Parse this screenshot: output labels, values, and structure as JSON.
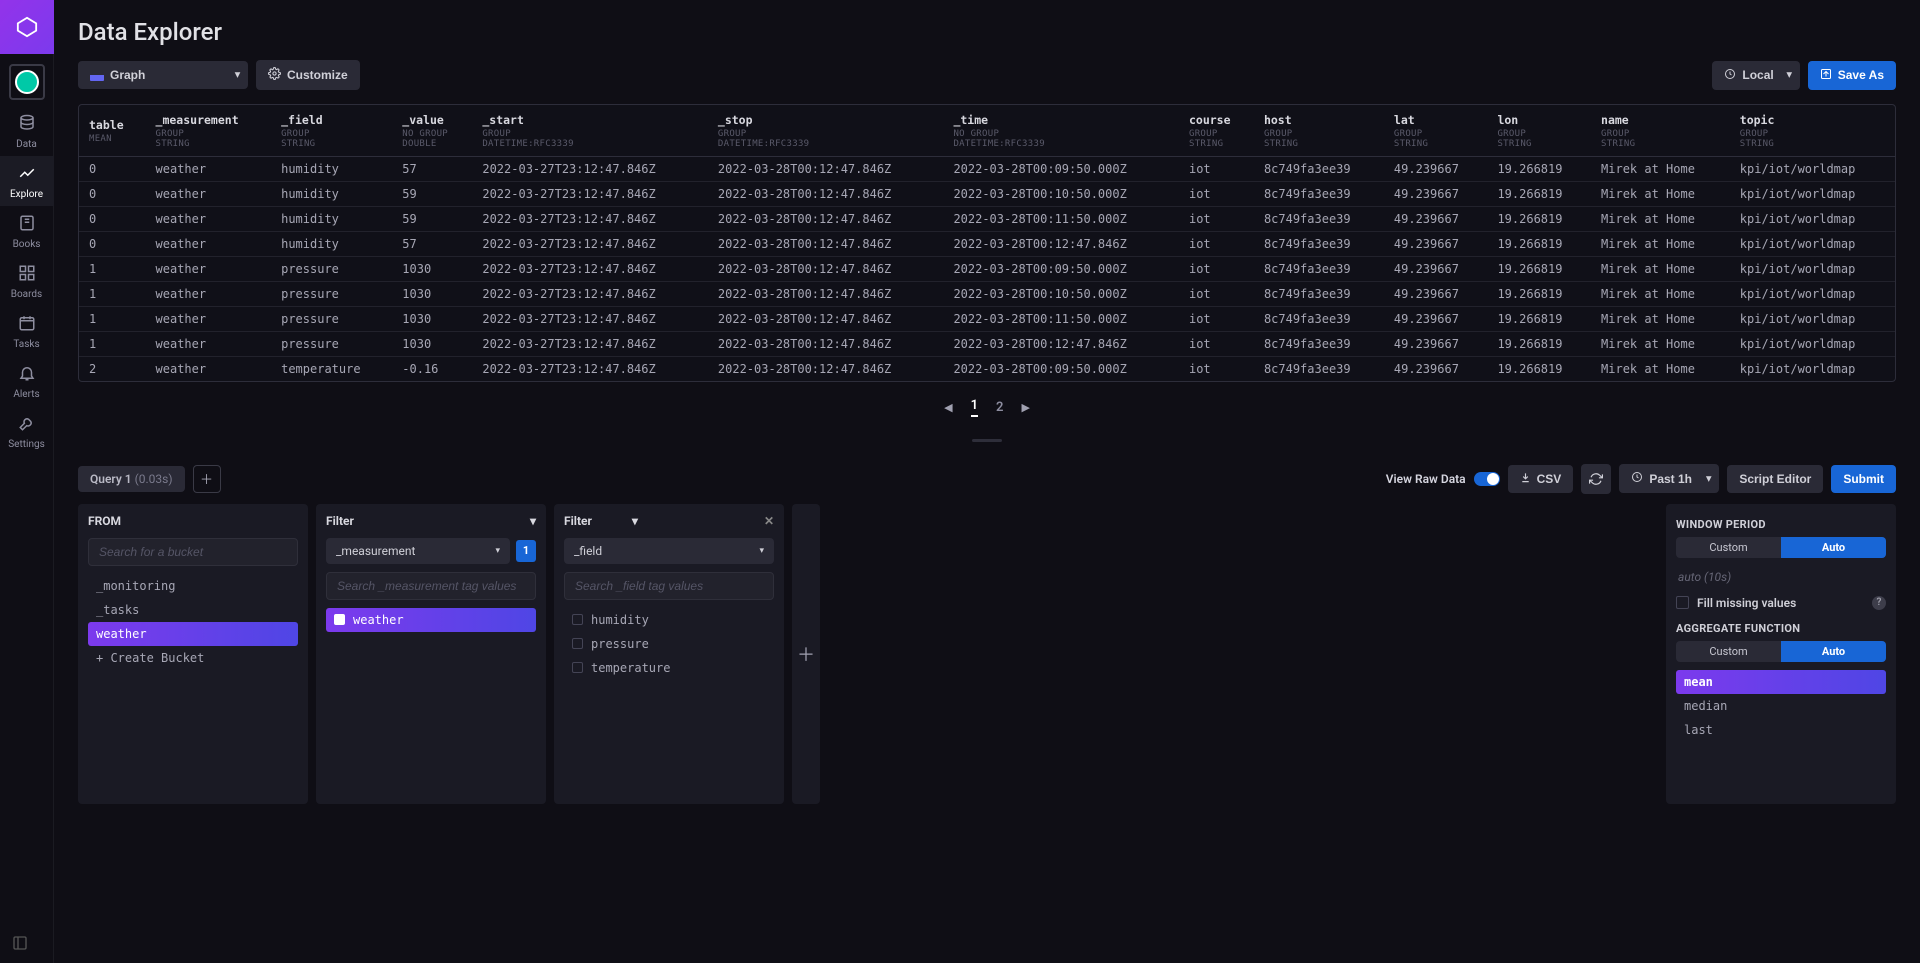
{
  "page_title": "Data Explorer",
  "sidebar": {
    "items": [
      {
        "label": "Data"
      },
      {
        "label": "Explore"
      },
      {
        "label": "Books"
      },
      {
        "label": "Boards"
      },
      {
        "label": "Tasks"
      },
      {
        "label": "Alerts"
      },
      {
        "label": "Settings"
      }
    ]
  },
  "toolbar": {
    "graph_label": "Graph",
    "customize_label": "Customize",
    "local_label": "Local",
    "save_as_label": "Save As"
  },
  "table": {
    "columns": [
      {
        "name": "table",
        "sub1": "MEAN",
        "sub2": ""
      },
      {
        "name": "_measurement",
        "sub1": "GROUP",
        "sub2": "STRING"
      },
      {
        "name": "_field",
        "sub1": "GROUP",
        "sub2": "STRING"
      },
      {
        "name": "_value",
        "sub1": "NO GROUP",
        "sub2": "DOUBLE"
      },
      {
        "name": "_start",
        "sub1": "GROUP",
        "sub2": "DATETIME:RFC3339"
      },
      {
        "name": "_stop",
        "sub1": "GROUP",
        "sub2": "DATETIME:RFC3339"
      },
      {
        "name": "_time",
        "sub1": "NO GROUP",
        "sub2": "DATETIME:RFC3339"
      },
      {
        "name": "course",
        "sub1": "GROUP",
        "sub2": "STRING"
      },
      {
        "name": "host",
        "sub1": "GROUP",
        "sub2": "STRING"
      },
      {
        "name": "lat",
        "sub1": "GROUP",
        "sub2": "STRING"
      },
      {
        "name": "lon",
        "sub1": "GROUP",
        "sub2": "STRING"
      },
      {
        "name": "name",
        "sub1": "GROUP",
        "sub2": "STRING"
      },
      {
        "name": "topic",
        "sub1": "GROUP",
        "sub2": "STRING"
      }
    ],
    "rows": [
      [
        "0",
        "weather",
        "humidity",
        "57",
        "2022-03-27T23:12:47.846Z",
        "2022-03-28T00:12:47.846Z",
        "2022-03-28T00:09:50.000Z",
        "iot",
        "8c749fa3ee39",
        "49.239667",
        "19.266819",
        "Mirek at Home",
        "kpi/iot/worldmap"
      ],
      [
        "0",
        "weather",
        "humidity",
        "59",
        "2022-03-27T23:12:47.846Z",
        "2022-03-28T00:12:47.846Z",
        "2022-03-28T00:10:50.000Z",
        "iot",
        "8c749fa3ee39",
        "49.239667",
        "19.266819",
        "Mirek at Home",
        "kpi/iot/worldmap"
      ],
      [
        "0",
        "weather",
        "humidity",
        "59",
        "2022-03-27T23:12:47.846Z",
        "2022-03-28T00:12:47.846Z",
        "2022-03-28T00:11:50.000Z",
        "iot",
        "8c749fa3ee39",
        "49.239667",
        "19.266819",
        "Mirek at Home",
        "kpi/iot/worldmap"
      ],
      [
        "0",
        "weather",
        "humidity",
        "57",
        "2022-03-27T23:12:47.846Z",
        "2022-03-28T00:12:47.846Z",
        "2022-03-28T00:12:47.846Z",
        "iot",
        "8c749fa3ee39",
        "49.239667",
        "19.266819",
        "Mirek at Home",
        "kpi/iot/worldmap"
      ],
      [
        "1",
        "weather",
        "pressure",
        "1030",
        "2022-03-27T23:12:47.846Z",
        "2022-03-28T00:12:47.846Z",
        "2022-03-28T00:09:50.000Z",
        "iot",
        "8c749fa3ee39",
        "49.239667",
        "19.266819",
        "Mirek at Home",
        "kpi/iot/worldmap"
      ],
      [
        "1",
        "weather",
        "pressure",
        "1030",
        "2022-03-27T23:12:47.846Z",
        "2022-03-28T00:12:47.846Z",
        "2022-03-28T00:10:50.000Z",
        "iot",
        "8c749fa3ee39",
        "49.239667",
        "19.266819",
        "Mirek at Home",
        "kpi/iot/worldmap"
      ],
      [
        "1",
        "weather",
        "pressure",
        "1030",
        "2022-03-27T23:12:47.846Z",
        "2022-03-28T00:12:47.846Z",
        "2022-03-28T00:11:50.000Z",
        "iot",
        "8c749fa3ee39",
        "49.239667",
        "19.266819",
        "Mirek at Home",
        "kpi/iot/worldmap"
      ],
      [
        "1",
        "weather",
        "pressure",
        "1030",
        "2022-03-27T23:12:47.846Z",
        "2022-03-28T00:12:47.846Z",
        "2022-03-28T00:12:47.846Z",
        "iot",
        "8c749fa3ee39",
        "49.239667",
        "19.266819",
        "Mirek at Home",
        "kpi/iot/worldmap"
      ],
      [
        "2",
        "weather",
        "temperature",
        "-0.16",
        "2022-03-27T23:12:47.846Z",
        "2022-03-28T00:12:47.846Z",
        "2022-03-28T00:09:50.000Z",
        "iot",
        "8c749fa3ee39",
        "49.239667",
        "19.266819",
        "Mirek at Home",
        "kpi/iot/worldmap"
      ]
    ]
  },
  "pagination": {
    "pages": [
      "1",
      "2"
    ],
    "current": "1"
  },
  "query_tab": {
    "label": "Query 1",
    "duration": "(0.03s)"
  },
  "qbar": {
    "view_raw_label": "View Raw Data",
    "csv_label": "CSV",
    "time_range": "Past 1h",
    "script_editor_label": "Script Editor",
    "submit_label": "Submit"
  },
  "from_panel": {
    "title": "FROM",
    "placeholder": "Search for a bucket",
    "items": [
      "_monitoring",
      "_tasks",
      "weather",
      "+ Create Bucket"
    ],
    "selected": "weather"
  },
  "filter1": {
    "title": "Filter",
    "dropdown": "_measurement",
    "badge": "1",
    "placeholder": "Search _measurement tag values",
    "items": [
      "weather"
    ],
    "selected": "weather"
  },
  "filter2": {
    "title": "Filter",
    "dropdown": "_field",
    "placeholder": "Search _field tag values",
    "items": [
      "humidity",
      "pressure",
      "temperature"
    ]
  },
  "window_panel": {
    "title": "WINDOW PERIOD",
    "custom": "Custom",
    "auto": "Auto",
    "auto_hint": "auto (10s)",
    "fill_missing": "Fill missing values",
    "agg_title": "AGGREGATE FUNCTION",
    "fns": [
      "mean",
      "median",
      "last"
    ],
    "selected_fn": "mean"
  }
}
